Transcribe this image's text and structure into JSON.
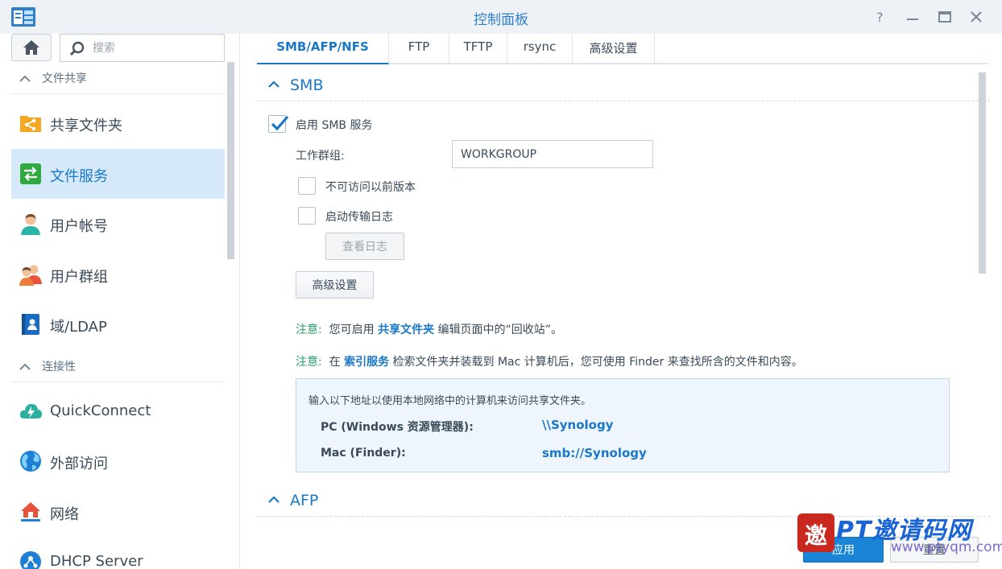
{
  "window": {
    "title": "控制面板",
    "controls": [
      "help-icon",
      "minimize-icon",
      "maximize-icon",
      "close-icon"
    ]
  },
  "sidebar": {
    "search_placeholder": "搜索",
    "sections": [
      {
        "label": "文件共享",
        "items": [
          {
            "label": "共享文件夹",
            "icon": "shared-folder-icon"
          },
          {
            "label": "文件服务",
            "icon": "file-services-icon",
            "active": true
          },
          {
            "label": "用户帐号",
            "icon": "user-icon"
          },
          {
            "label": "用户群组",
            "icon": "group-icon"
          },
          {
            "label": "域/LDAP",
            "icon": "ldap-icon"
          }
        ]
      },
      {
        "label": "连接性",
        "items": [
          {
            "label": "QuickConnect",
            "icon": "quickconnect-icon"
          },
          {
            "label": "外部访问",
            "icon": "globe-icon"
          },
          {
            "label": "网络",
            "icon": "network-icon"
          },
          {
            "label": "DHCP Server",
            "icon": "dhcp-icon"
          }
        ]
      }
    ]
  },
  "tabs": [
    {
      "label": "SMB/AFP/NFS",
      "active": true
    },
    {
      "label": "FTP"
    },
    {
      "label": "TFTP"
    },
    {
      "label": "rsync"
    },
    {
      "label": "高级设置"
    }
  ],
  "smb": {
    "title": "SMB",
    "enable_label": "启用 SMB 服务",
    "enable_checked": true,
    "workgroup_label": "工作群组:",
    "workgroup_value": "WORKGROUP",
    "prev_versions_label": "不可访问以前版本",
    "prev_versions_checked": false,
    "transfer_log_label": "启动传输日志",
    "transfer_log_checked": false,
    "view_log_button": "查看日志",
    "advanced_button": "高级设置",
    "note1": {
      "prefix": "注意:",
      "before": "您可启用",
      "link": "共享文件夹",
      "after": "编辑页面中的“回收站”。"
    },
    "note2": {
      "prefix": "注意:",
      "before": "在",
      "link": "索引服务",
      "after": "检索文件夹并装载到 Mac 计算机后，您可使用 Finder 来查找所含的文件和内容。"
    },
    "info": {
      "intro": "输入以下地址以使用本地网络中的计算机来访问共享文件夹。",
      "rows": [
        {
          "key": "PC (Windows 资源管理器):",
          "value": "\\\\Synology"
        },
        {
          "key": "Mac (Finder):",
          "value": "smb://Synology"
        }
      ]
    }
  },
  "afp": {
    "title": "AFP"
  },
  "footer": {
    "apply": "应用",
    "reset": "重置"
  },
  "watermark": {
    "text": "PT邀请码网",
    "seal": "邀",
    "url": "www.ptyqm.com"
  },
  "colors": {
    "accent": "#1a78c8",
    "note_green": "#2aa06a",
    "active_bg": "#d6e9fb"
  }
}
